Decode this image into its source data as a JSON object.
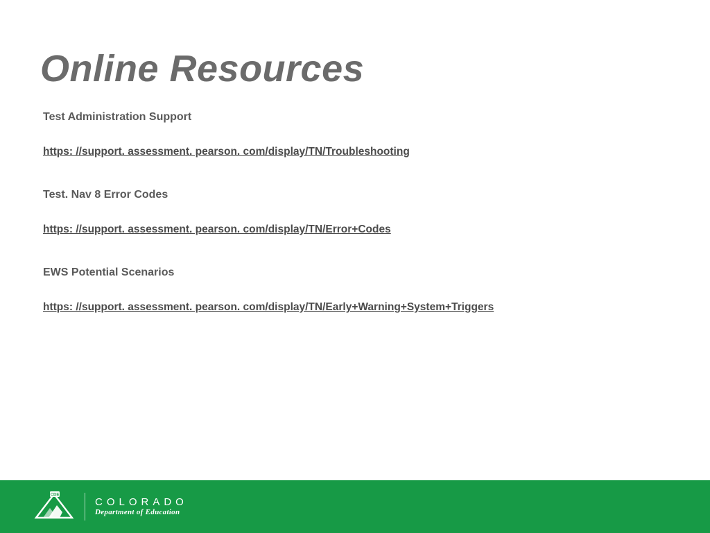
{
  "title": "Online Resources",
  "sections": [
    {
      "heading": "Test Administration Support",
      "link": "https: //support. assessment. pearson. com/display/TN/Troubleshooting"
    },
    {
      "heading": "Test. Nav 8 Error Codes",
      "link": "https: //support. assessment. pearson. com/display/TN/Error+Codes"
    },
    {
      "heading": "EWS Potential Scenarios",
      "link": "https: //support. assessment. pearson. com/display/TN/Early+Warning+System+Triggers"
    }
  ],
  "footer": {
    "logo_badge": "CDE",
    "logo_top": "COLORADO",
    "logo_bottom": "Department of Education"
  },
  "colors": {
    "footer_bg": "#179a46",
    "title_gray": "#6b6b6b"
  }
}
